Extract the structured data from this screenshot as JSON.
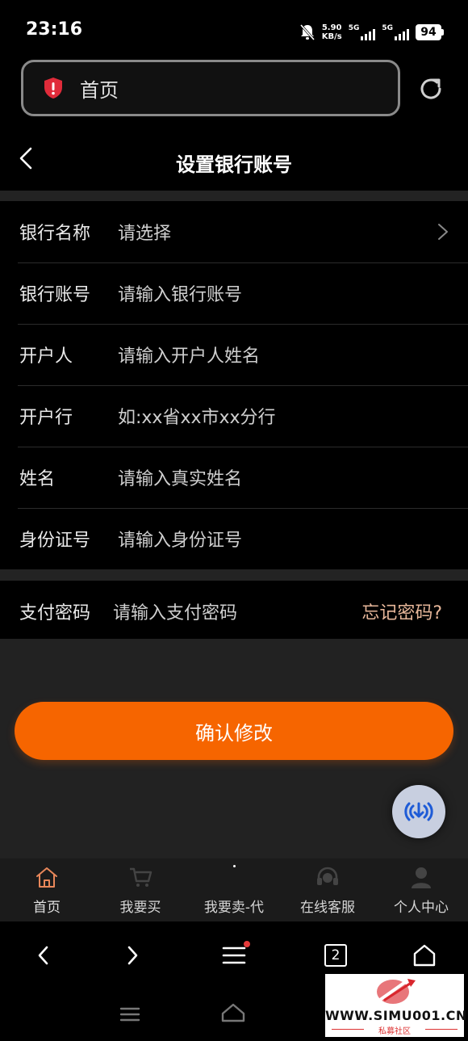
{
  "status_bar": {
    "time": "23:16",
    "speed_value": "5.90",
    "speed_unit": "KB/s",
    "network_1": "5G",
    "network_2": "5G",
    "battery": "94"
  },
  "browser": {
    "address_text": "首页"
  },
  "header": {
    "title": "设置银行账号"
  },
  "form": {
    "rows": [
      {
        "label": "银行名称",
        "value": "请选择"
      },
      {
        "label": "银行账号",
        "value": "请输入银行账号"
      },
      {
        "label": "开户人",
        "value": "请输入开户人姓名"
      },
      {
        "label": "开户行",
        "value": "如:xx省xx市xx分行"
      },
      {
        "label": "姓名",
        "value": "请输入真实姓名"
      },
      {
        "label": "身份证号",
        "value": "请输入身份证号"
      }
    ],
    "password": {
      "label": "支付密码",
      "placeholder": "请输入支付密码",
      "forgot": "忘记密码?"
    },
    "confirm": "确认修改"
  },
  "tabbar": {
    "items": [
      {
        "label": "首页",
        "icon": "home-icon"
      },
      {
        "label": "我要买",
        "icon": "cart-icon"
      },
      {
        "label": "我要卖-代",
        "icon": "sell-icon"
      },
      {
        "label": "在线客服",
        "icon": "headset-icon"
      },
      {
        "label": "个人中心",
        "icon": "user-icon"
      }
    ]
  },
  "browser_nav": {
    "tab_count": "2"
  },
  "watermark": {
    "text": "WWW.SIMU001.CN",
    "sub": "私募社区"
  },
  "colors": {
    "accent": "#f66500",
    "forgot": "#e7b79a",
    "background": "#000000",
    "fill": "#222222"
  }
}
